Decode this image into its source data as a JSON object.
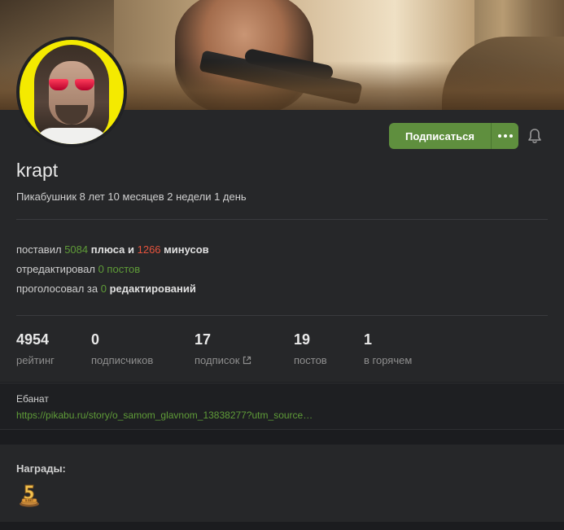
{
  "profile": {
    "username": "krapt",
    "age_text": "Пикабушник 8 лет 10 месяцев 2 недели 1 день",
    "subscribe_label": "Подписаться"
  },
  "activity": {
    "line1": {
      "prefix": "поставил ",
      "pluses": "5084",
      "mid": " плюса и ",
      "minuses": "1266",
      "suffix": " минусов"
    },
    "line2": {
      "prefix": "отредактировал ",
      "value": "0 постов"
    },
    "line3": {
      "prefix": "проголосовал за ",
      "value": "0",
      "suffix": " редактирований"
    }
  },
  "counters": [
    {
      "value": "4954",
      "label": "рейтинг"
    },
    {
      "value": "0",
      "label": "подписчиков"
    },
    {
      "value": "17",
      "label": "подписок"
    },
    {
      "value": "19",
      "label": "постов"
    },
    {
      "value": "1",
      "label": "в горячем"
    }
  ],
  "about": {
    "title": "Ебанат",
    "link": "https://pikabu.ru/story/o_samom_glavnom_13838277?utm_source…"
  },
  "awards": {
    "title": "Награды:",
    "badge_text": "5 ЛЕТ"
  },
  "colors": {
    "accent_green": "#5f8f3e",
    "text_green": "#5f9c38",
    "text_red": "#e5533d",
    "panel_bg": "#262729"
  },
  "icons": [
    "more-dots-icon",
    "bell-icon",
    "external-link-icon",
    "award-five-years-icon"
  ]
}
